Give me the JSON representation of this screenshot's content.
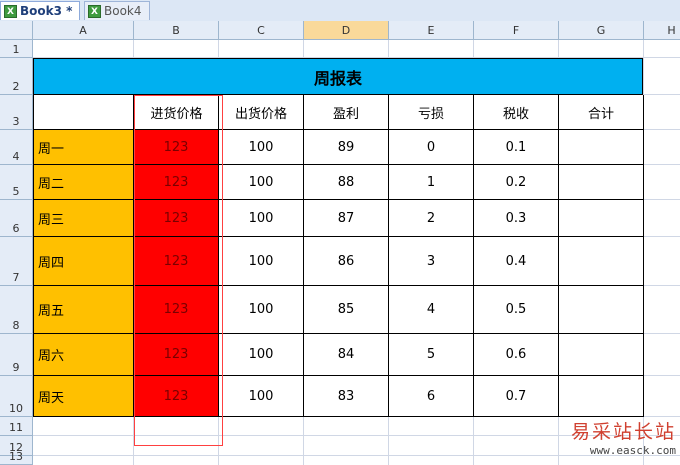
{
  "tabs": [
    {
      "label": "Book3 *",
      "icon": "excel-workbook-icon",
      "active": true
    },
    {
      "label": "Book4",
      "icon": "excel-workbook-icon",
      "active": false
    }
  ],
  "columns": [
    "A",
    "B",
    "C",
    "D",
    "E",
    "F",
    "G",
    "H"
  ],
  "active_column": "D",
  "rows": [
    "1",
    "2",
    "3",
    "4",
    "5",
    "6",
    "7",
    "8",
    "9",
    "10",
    "11",
    "12",
    "13"
  ],
  "table": {
    "title": "周报表",
    "headers": [
      "进货价格",
      "出货价格",
      "盈利",
      "亏损",
      "税收",
      "合计"
    ],
    "days": [
      "周一",
      "周二",
      "周三",
      "周四",
      "周五",
      "周六",
      "周天"
    ],
    "purchase": [
      "123",
      "123",
      "123",
      "123",
      "123",
      "123",
      "123"
    ],
    "sale": [
      "100",
      "100",
      "100",
      "100",
      "100",
      "100",
      "100"
    ],
    "profit": [
      "89",
      "88",
      "87",
      "86",
      "85",
      "84",
      "83"
    ],
    "loss": [
      "0",
      "1",
      "2",
      "3",
      "4",
      "5",
      "6"
    ],
    "tax": [
      "0.1",
      "0.2",
      "0.3",
      "0.4",
      "0.5",
      "0.6",
      "0.7"
    ],
    "total": [
      "",
      "",
      "",
      "",
      "",
      "",
      ""
    ]
  },
  "colors": {
    "title_fill": "#00b0f0",
    "day_fill": "#ffc000",
    "purchase_fill": "#ff0000"
  },
  "watermark": {
    "text": "易采站长站",
    "url": "www.easck.com"
  }
}
